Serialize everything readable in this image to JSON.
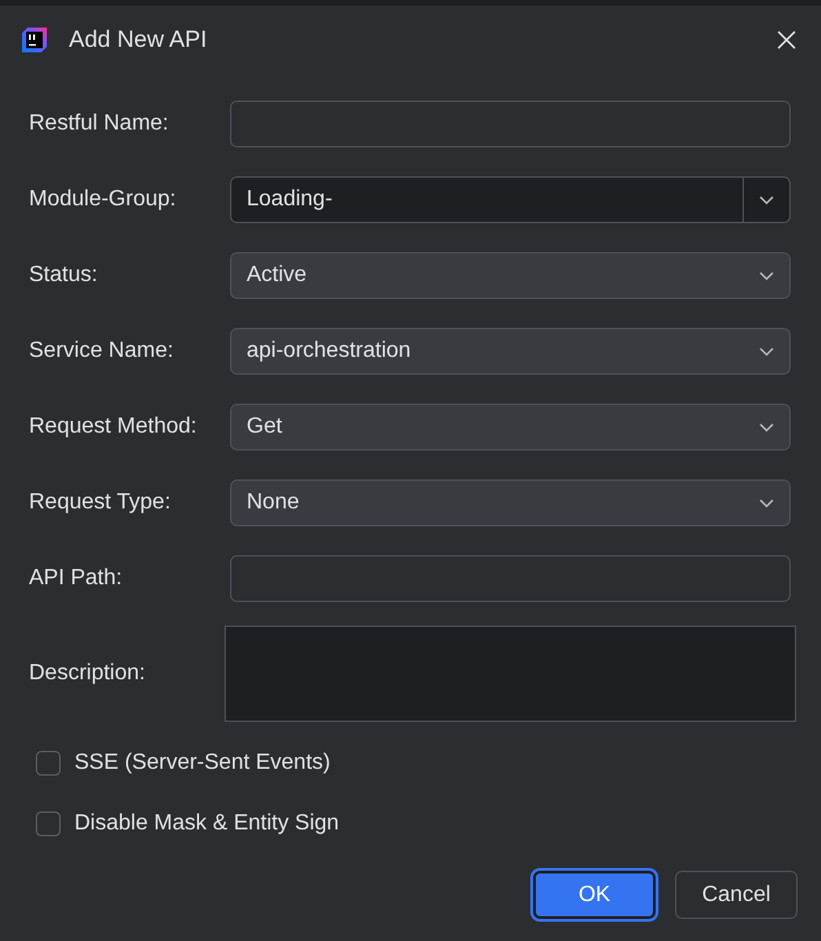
{
  "window": {
    "title": "Add New API"
  },
  "fields": [
    {
      "label": "Restful Name:",
      "kind": "text"
    },
    {
      "label": "Module-Group:",
      "kind": "editable-combo",
      "value": "Loading-"
    },
    {
      "label": "Status:",
      "kind": "combo",
      "value": "Active"
    },
    {
      "label": "Service Name:",
      "kind": "combo",
      "value": "api-orchestration"
    },
    {
      "label": "Request Method:",
      "kind": "combo",
      "value": "Get"
    },
    {
      "label": "Request Type:",
      "kind": "combo",
      "value": "None"
    },
    {
      "label": "API Path:",
      "kind": "text"
    },
    {
      "label": "Description:",
      "kind": "textarea"
    }
  ],
  "checkboxes": [
    {
      "label": "SSE (Server-Sent Events)",
      "checked": false
    },
    {
      "label": "Disable Mask & Entity Sign",
      "checked": false
    }
  ],
  "buttons": [
    {
      "label": "OK",
      "kind": "primary"
    },
    {
      "label": "Cancel",
      "kind": "secondary"
    }
  ]
}
